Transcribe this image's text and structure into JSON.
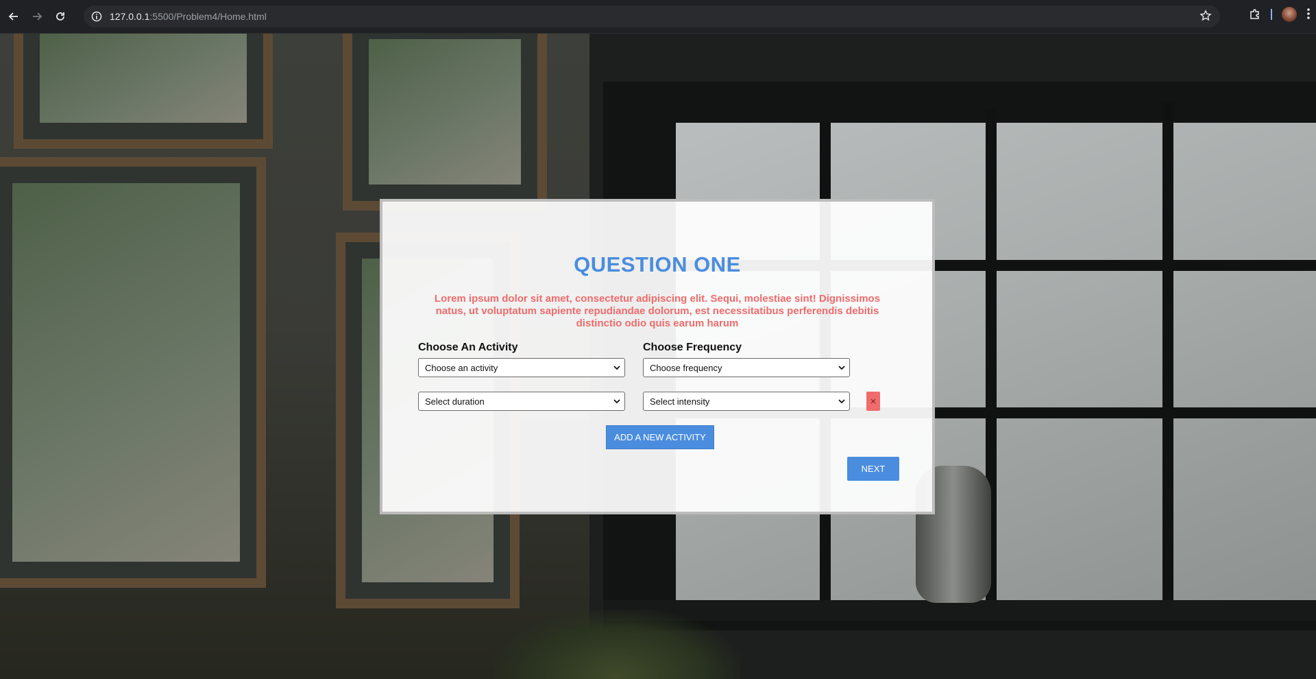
{
  "browser": {
    "url_host": "127.0.0.1",
    "url_rest": ":5500/Problem4/Home.html",
    "icons": [
      "back-icon",
      "forward-icon",
      "reload-icon",
      "site-info-icon",
      "bookmark-star-icon",
      "extensions-icon",
      "profile-avatar",
      "menu-icon"
    ]
  },
  "question": {
    "title": "QUESTION ONE",
    "description": "Lorem ipsum dolor sit amet, consectetur adipiscing elit. Sequi, molestiae sint! Dignissimos natus, ut voluptatum sapiente repudiandae dolorum, est necessitatibus perferendis debitis distinctio odio quis earum harum"
  },
  "form": {
    "activity_label": "Choose An Activity",
    "frequency_label": "Choose Frequency",
    "activity_value": "Choose an activity",
    "frequency_value": "Choose frequency",
    "duration_value": "Select duration",
    "intensity_value": "Select intensity",
    "remove_symbol": "×",
    "add_button": "ADD A NEW ACTIVITY",
    "next_button": "NEXT"
  },
  "colors": {
    "accent_blue": "#4a8ddf",
    "accent_red": "#f06b6b"
  }
}
